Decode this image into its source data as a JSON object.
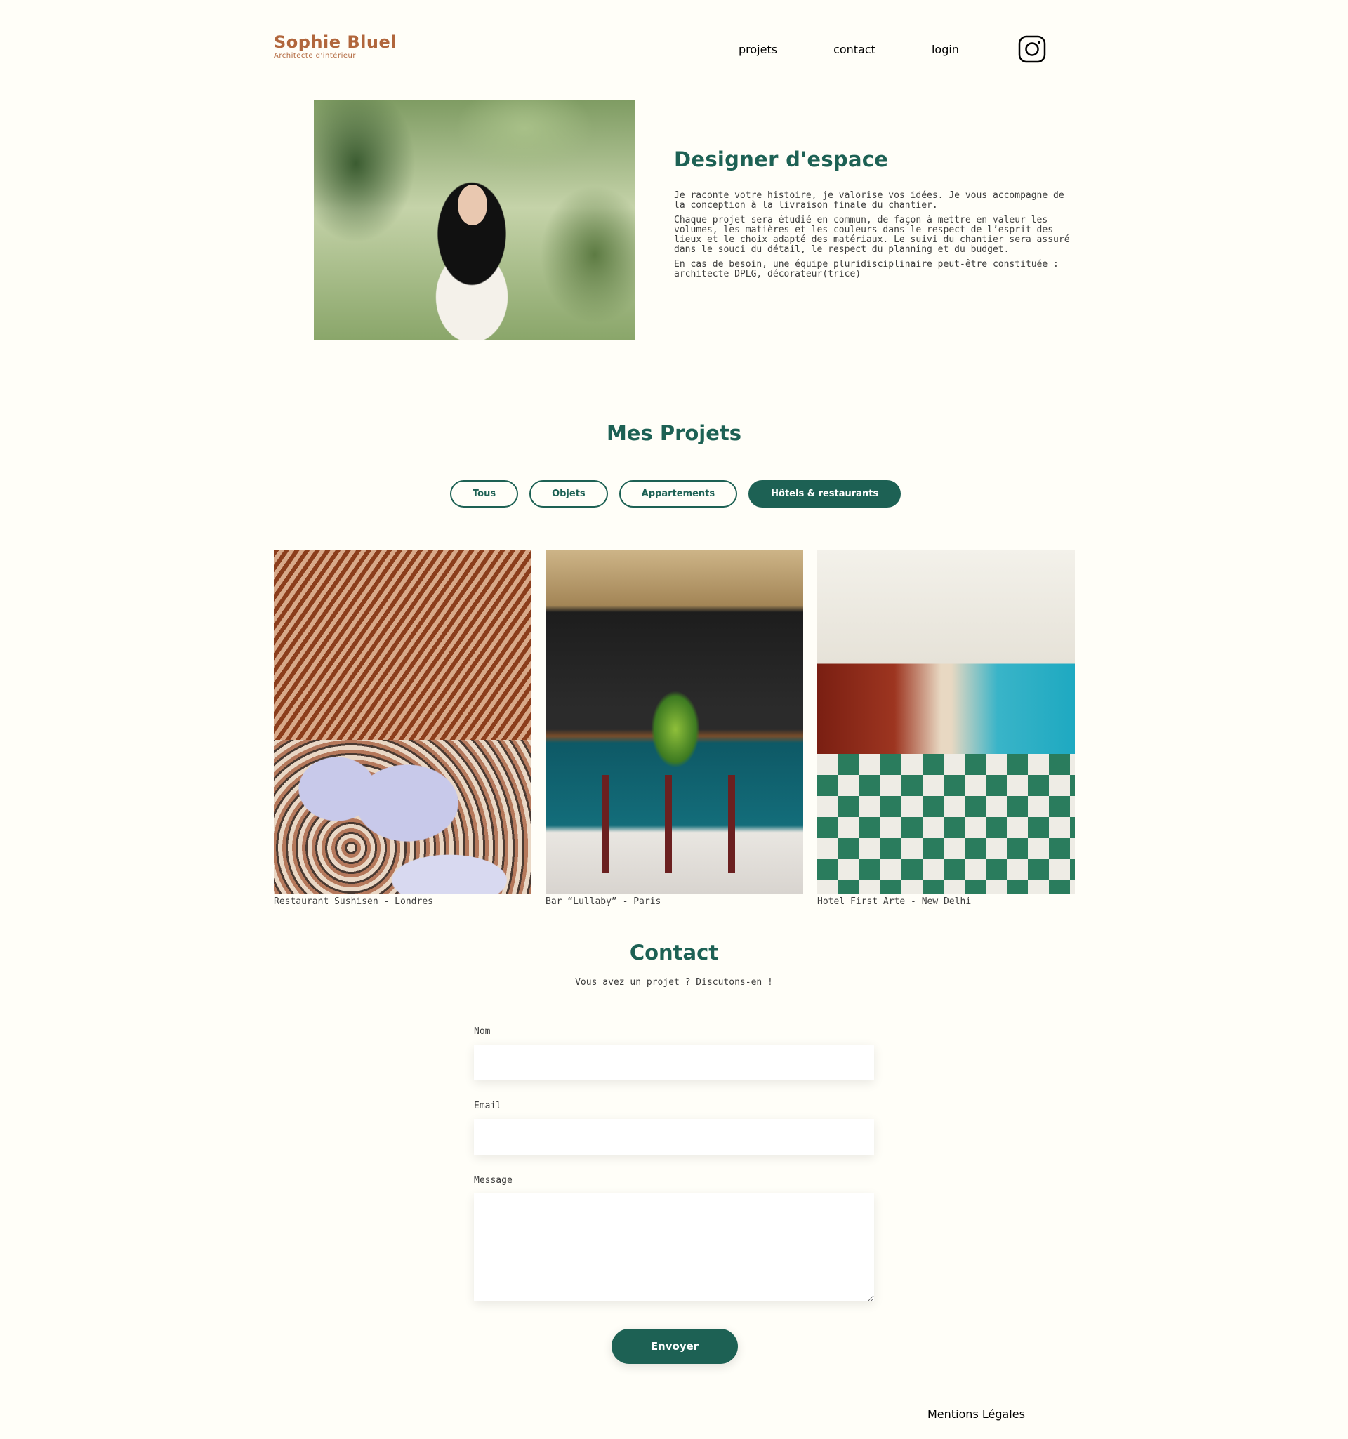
{
  "header": {
    "logo_title": "Sophie Bluel",
    "logo_subtitle": "Architecte d'intérieur",
    "nav": [
      "projets",
      "contact",
      "login"
    ],
    "social_icon": "instagram-icon"
  },
  "intro": {
    "title": "Designer d'espace",
    "paragraphs": [
      "Je raconte votre histoire, je valorise vos idées. Je vous accompagne de la conception à la livraison finale du chantier.",
      "Chaque projet sera étudié en commun, de façon à mettre en valeur les volumes, les matières et les couleurs dans le respect de l’esprit des lieux et le choix adapté des matériaux. Le suivi du chantier sera assuré dans le souci du détail, le respect du planning et du budget.",
      "En cas de besoin, une équipe pluridisciplinaire peut-être constituée : architecte DPLG, décorateur(trice)"
    ]
  },
  "projects": {
    "title": "Mes Projets",
    "filters": [
      "Tous",
      "Objets",
      "Appartements",
      "Hôtels & restaurants"
    ],
    "active_filter": "Hôtels & restaurants",
    "items": [
      {
        "caption": "Restaurant Sushisen - Londres"
      },
      {
        "caption": "Bar “Lullaby” - Paris"
      },
      {
        "caption": "Hotel First Arte - New Delhi"
      }
    ]
  },
  "contact": {
    "title": "Contact",
    "subtitle": "Vous avez un projet ? Discutons-en !",
    "fields": {
      "name_label": "Nom",
      "email_label": "Email",
      "message_label": "Message"
    },
    "submit_label": "Envoyer"
  },
  "footer": {
    "legal_link": "Mentions Légales"
  },
  "colors": {
    "accent": "#1D6154",
    "brand": "#B1663C",
    "background": "#FFFEF8"
  }
}
